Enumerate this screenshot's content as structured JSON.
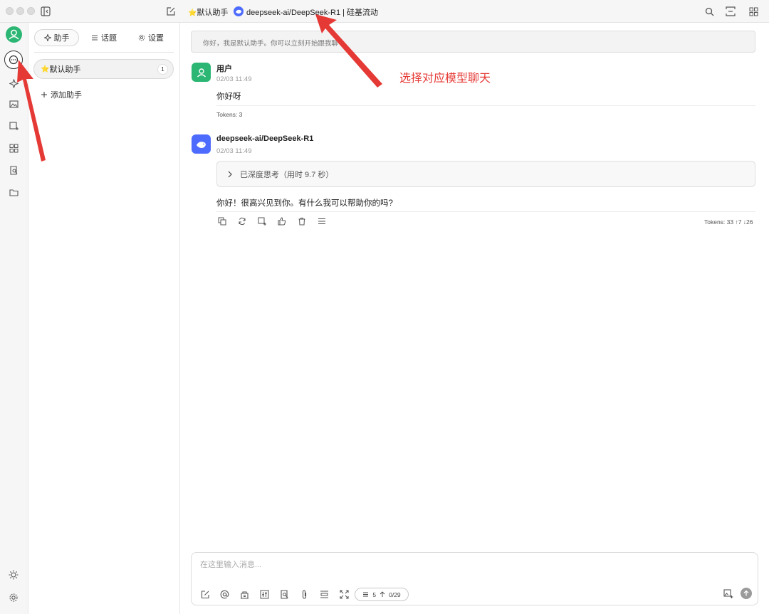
{
  "header": {
    "assistant_emoji": "⭐",
    "assistant_name": "默认助手",
    "model_label": "deepseek-ai/DeepSeek-R1 | 硅基流动"
  },
  "sidebar_tabs": [
    {
      "label": "助手",
      "active": true
    },
    {
      "label": "话题",
      "active": false
    },
    {
      "label": "设置",
      "active": false
    }
  ],
  "assistants": [
    {
      "emoji": "⭐",
      "name": "默认助手",
      "count": "1"
    }
  ],
  "add_assistant_label": "添加助手",
  "prompt_banner": "你好，我是默认助手。你可以立刻开始跟我聊",
  "messages": [
    {
      "sender": "用户",
      "time": "02/03 11:49",
      "text": "你好呀",
      "tokens": "Tokens: 3"
    },
    {
      "sender": "deepseek-ai/DeepSeek-R1",
      "time": "02/03 11:49",
      "thinking": "已深度思考（用时 9.7 秒）",
      "text": "你好！很高兴见到你。有什么我可以帮助你的吗?",
      "tokens": "Tokens: 33 ↑7 ↓26"
    }
  ],
  "annotation": "选择对应模型聊天",
  "composer": {
    "placeholder": "在这里输入消息...",
    "context_count": "5",
    "token_count": "0/29"
  },
  "colors": {
    "accent_red": "#e53935",
    "user_avatar": "#2bb673",
    "model_avatar": "#4d6bfe"
  }
}
